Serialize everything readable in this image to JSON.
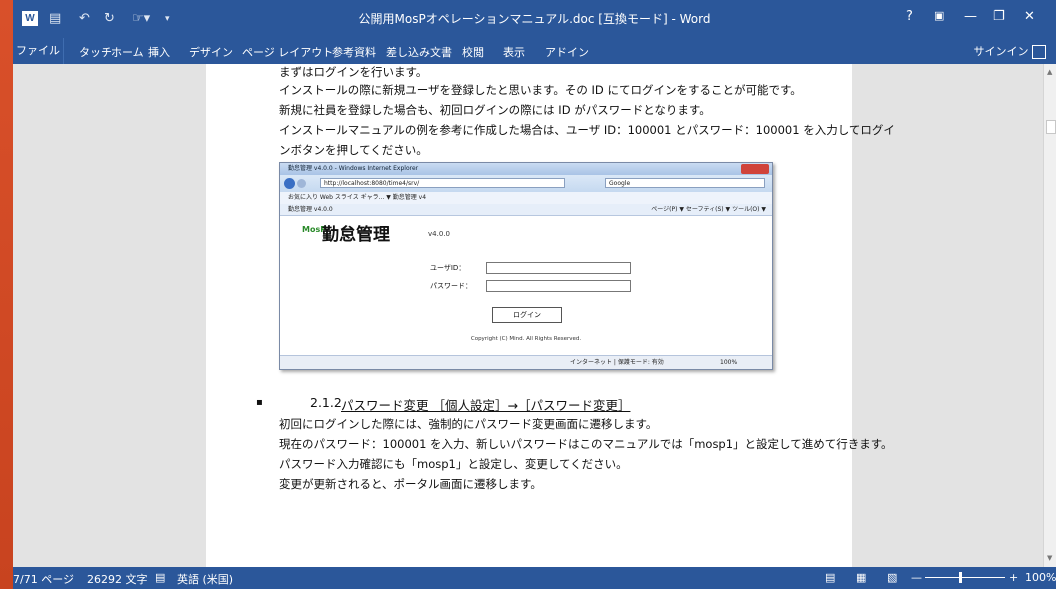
{
  "window": {
    "title": "公開用MosPオペレーションマニュアル.doc [互換モード] - Word",
    "signin": "サインイン",
    "icons": [
      "word-logo-icon",
      "save-icon",
      "undo-icon",
      "redo-icon",
      "touch-mode-icon",
      "customize-icon"
    ]
  },
  "ribbon": {
    "file_tab": "ファイル",
    "tabs": [
      "タッチ",
      "ホーム",
      "挿入",
      "デザイン",
      "ページ レイアウト",
      "参考資料",
      "差し込み文書",
      "校閲",
      "表示",
      "アドイン"
    ]
  },
  "document": {
    "lines_top": [
      "まずはログインを行います。",
      "インストールの際に新規ユーザを登録したと思います。その ID にてログインをすることが可能です。",
      "新規に社員を登録した場合も、初回ログインの際には ID がパスワードとなります。",
      "インストールマニュアルの例を参考に作成した場合は、ユーザ ID：100001 とパスワード：100001 を入力してログイ",
      "ンボタンを押してください。"
    ],
    "bullet": "▪",
    "heading": "2.1.2",
    "heading_text": "パスワード変更 ［個人設定］→［パスワード変更］",
    "lines_bottom": [
      "初回にログインした際には、強制的にパスワード変更画面に遷移します。",
      "現在のパスワード：100001 を入力、新しいパスワードはこのマニュアルでは「mosp1」と設定して進めて行きます。",
      "パスワード入力確認にも「mosp1」と設定し、変更してください。",
      "変更が更新されると、ポータル画面に遷移します。"
    ]
  },
  "screenshot": {
    "ie_title": "勤怠管理 v4.0.0 - Windows Internet Explorer",
    "url": "http://localhost:8080/time4/srv/",
    "search": "Google",
    "favorites": "お気に入り    Web スライス ギャラ... ▼    勤怠管理 v4",
    "tab": "勤怠管理 v4.0.0",
    "tools": "ページ(P) ▼  セーフティ(S) ▼  ツール(O) ▼",
    "logo": "MosP",
    "app_title": "勤怠管理",
    "version": "v4.0.0",
    "user_id_label": "ユーザID：",
    "password_label": "パスワード：",
    "login_button": "ログイン",
    "copyright": "Copyright (C) Mind. All Rights Reserved.",
    "status": "インターネット | 保護モード: 有効",
    "zoom": "100%"
  },
  "status": {
    "page": "7/71 ページ",
    "words": "26292 文字",
    "language": "英語 (米国)",
    "zoom": "100%"
  },
  "colors": {
    "accent": "#2b579a",
    "orange": "#d9502a"
  }
}
